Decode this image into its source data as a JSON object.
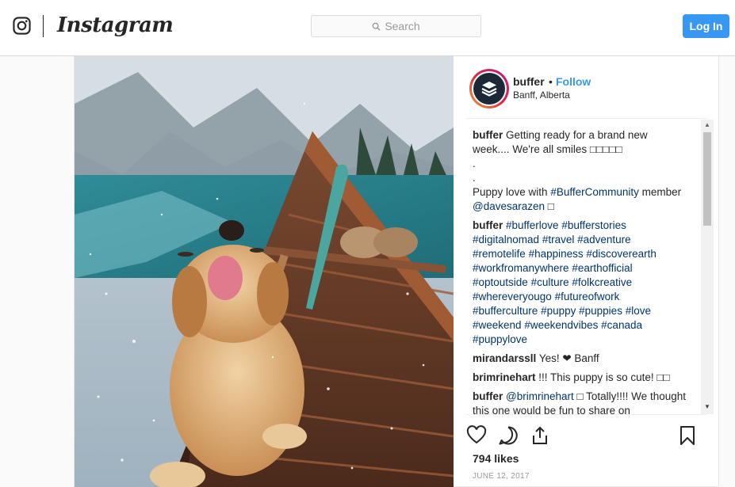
{
  "header": {
    "brand": "Instagram",
    "search_placeholder": "Search",
    "login_label": "Log In"
  },
  "post": {
    "username": "buffer",
    "separator": "•",
    "follow_label": "Follow",
    "location": "Banff, Alberta",
    "caption": {
      "author": "buffer",
      "lines": [
        "Getting ready for a brand new week.... We're all smiles □□□□□",
        ".",
        ".",
        "Puppy love with ",
        "member "
      ],
      "text_1": "Getting ready for a brand new week.... We're all smiles □□□□□",
      "dot_1": ".",
      "dot_2": ".",
      "text_2": "Puppy love with ",
      "tag_community": "#BufferCommunity",
      "text_3": "member ",
      "mention": "@davesarazen",
      "text_4": " □"
    },
    "hashtag_comment": {
      "author": "buffer",
      "tags": [
        "#bufferlove",
        "#bufferstories",
        "#digitalnomad",
        "#travel",
        "#adventure",
        "#remotelife",
        "#happiness",
        "#discoverearth",
        "#workfromanywhere",
        "#earthofficial",
        "#optoutside",
        "#culture",
        "#folkcreative",
        "#whereveryougo",
        "#futureofwork",
        "#bufferculture",
        "#puppy",
        "#puppies",
        "#love",
        "#weekend",
        "#weekendvibes",
        "#canada",
        "#puppylove"
      ]
    },
    "comments": [
      {
        "author": "mirandarssll",
        "text": "Yes! ❤ Banff"
      },
      {
        "author": "brimrinehart",
        "text": "!!! This puppy is so cute! □□"
      },
      {
        "author": "buffer",
        "mention": "@brimrinehart",
        "text": " □ Totally!!!! We thought this one would be fun to share on"
      }
    ],
    "likes": "794 likes",
    "date": "JUNE 12, 2017"
  },
  "icons": {
    "instagram": "instagram-glyph-icon",
    "search": "search-icon",
    "like": "heart-icon",
    "comment": "comment-icon",
    "share": "share-icon",
    "save": "bookmark-icon"
  },
  "colors": {
    "accent": "#3897f0",
    "hashtag": "#003569",
    "text": "#262626",
    "muted": "#999999"
  }
}
